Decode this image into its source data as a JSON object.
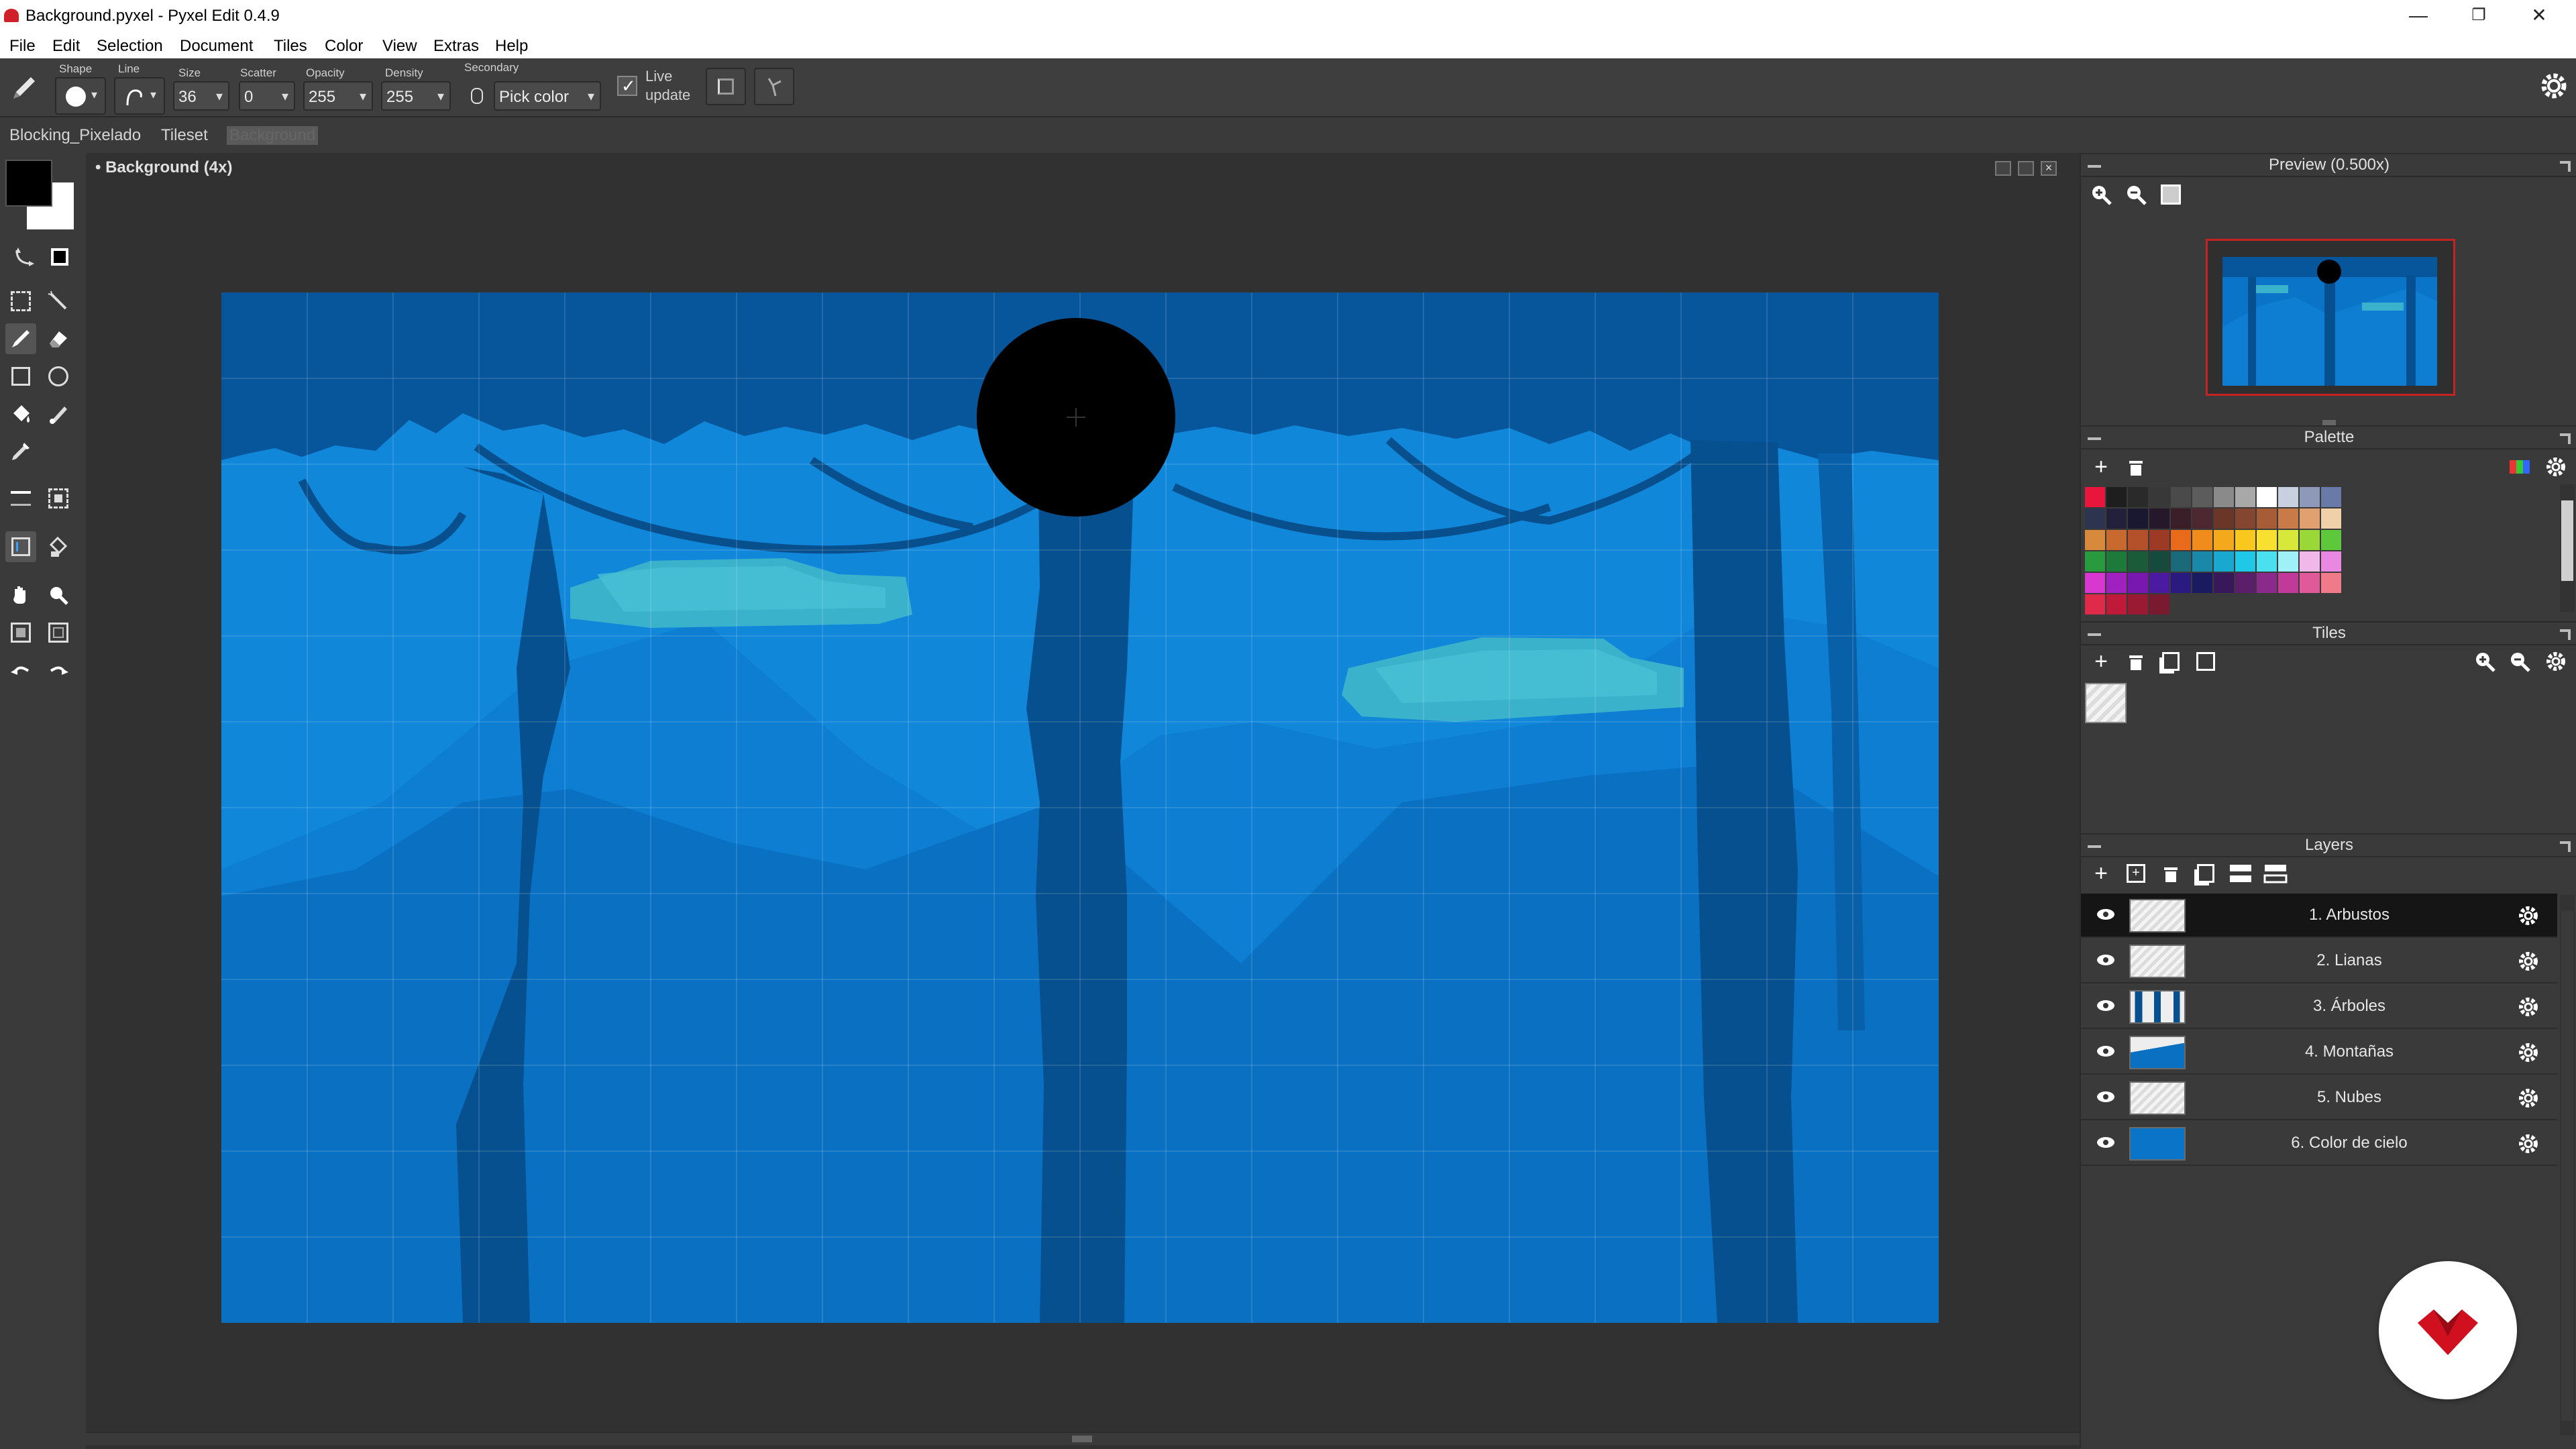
{
  "window": {
    "title": "Background.pyxel - Pyxel Edit 0.4.9",
    "minimize": "—",
    "restore": "❐",
    "close": "✕"
  },
  "menu": [
    "File",
    "Edit",
    "Selection",
    "Document",
    "Tiles",
    "Color",
    "View",
    "Extras",
    "Help"
  ],
  "toolbar": {
    "shape_label": "Shape",
    "line_label": "Line",
    "size_label": "Size",
    "size_value": "36",
    "scatter_label": "Scatter",
    "scatter_value": "0",
    "opacity_label": "Opacity",
    "opacity_value": "255",
    "density_label": "Density",
    "density_value": "255",
    "secondary_label": "Secondary",
    "secondary_value": "Pick color",
    "live_update_label_1": "Live",
    "live_update_label_2": "update",
    "live_update_checked": true
  },
  "doc_tabs": [
    "Blocking_Pixelado",
    "Tileset",
    "Background"
  ],
  "document": {
    "header": "• Background  (4x)"
  },
  "colors": {
    "primary": "#000000",
    "secondary": "#ffffff",
    "sky": "#0a75c8",
    "sky_top": "#07559a",
    "tree": "#06508f",
    "mountain_far": "#0f82d6",
    "mountain_near": "#0e78cc",
    "cloud": "#3bb2cc",
    "cloud_light": "#48bfd4"
  },
  "panels": {
    "preview_title": "Preview (0.500x)",
    "palette_title": "Palette",
    "tiles_title": "Tiles",
    "layers_title": "Layers"
  },
  "palette": [
    [
      "#e8163c",
      "#1e1e1e",
      "#2a2a2a",
      "#383838",
      "#4a4a4a",
      "#5c5c5c",
      "#8a8a8a",
      "#a8a8a8",
      "#ffffff",
      "#c8d0e0",
      "#8e98b8",
      "#6a7aa8"
    ],
    [
      "#2c3450",
      "#22203a",
      "#1a1830",
      "#24182a",
      "#3a1e28",
      "#4e2830",
      "#6a3628",
      "#844630",
      "#a65c34",
      "#c87a48",
      "#e0a070",
      "#f0d0a8"
    ],
    [
      "#d88a3c",
      "#c86a2e",
      "#b4502a",
      "#9c3a26",
      "#e86a1a",
      "#f08c1c",
      "#f4a81c",
      "#f8c81e",
      "#f8e030",
      "#d8e83a",
      "#9ad838",
      "#5cc83a"
    ],
    [
      "#2a9a3e",
      "#1e7a3a",
      "#1a5c3a",
      "#164a3c",
      "#1a6a7a",
      "#1a88a8",
      "#18a8d0",
      "#20c8e8",
      "#4ae0f0",
      "#a0f0f8",
      "#f0b8e8",
      "#e888e0"
    ],
    [
      "#d838d0",
      "#a020c0",
      "#7818b0",
      "#4a1aa0",
      "#2a1a80",
      "#1a1a60",
      "#38185a",
      "#5a1e6a",
      "#8a2a8a",
      "#c03a9a",
      "#e05a9a",
      "#f07a8a"
    ],
    [
      "#e02a4a",
      "#c01a3a",
      "#9a1a34",
      "#7a1a30"
    ]
  ],
  "layers": [
    {
      "name": "1. Arbustos",
      "selected": true
    },
    {
      "name": "2. Lianas",
      "selected": false
    },
    {
      "name": "3. Árboles",
      "selected": false
    },
    {
      "name": "4. Montañas",
      "selected": false
    },
    {
      "name": "5. Nubes",
      "selected": false
    },
    {
      "name": "6. Color de cielo",
      "selected": false
    }
  ]
}
